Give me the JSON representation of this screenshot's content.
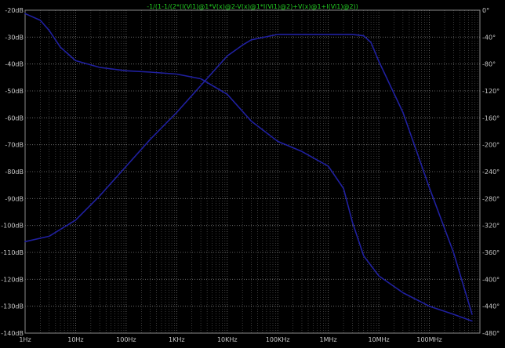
{
  "window": {
    "background": "#000000"
  },
  "plot": {
    "expression": "-1/(1-1/(2*(I(Vi1)@1*V(x)@2-V(x)@1*I(Vi1)@2)+V(x)@1+I(Vi1)@2))",
    "grid_color": "#606060",
    "trace_color": "#2020a0",
    "expression_color": "#22cc22"
  },
  "chart_data": {
    "type": "line",
    "title": "-1/(1-1/(2*(I(Vi1)@1*V(x)@2-V(x)@1*I(Vi1)@2)+V(x)@1+I(Vi1)@2))",
    "x_scale": "log",
    "xlim": [
      1,
      1000000000
    ],
    "x_ticks": [
      1,
      10,
      100,
      1000,
      10000,
      100000,
      1000000,
      10000000,
      100000000
    ],
    "x_tick_labels": [
      "1Hz",
      "10Hz",
      "100Hz",
      "1KHz",
      "10KHz",
      "100KHz",
      "1MHz",
      "10MHz",
      "100MHz"
    ],
    "ylim_left": [
      -140,
      -20
    ],
    "y_left_ticks": [
      -20,
      -30,
      -40,
      -50,
      -60,
      -70,
      -80,
      -90,
      -100,
      -110,
      -120,
      -130,
      -140
    ],
    "y_left_tick_labels": [
      "-20dB",
      "-30dB",
      "-40dB",
      "-50dB",
      "-60dB",
      "-70dB",
      "-80dB",
      "-90dB",
      "-100dB",
      "-110dB",
      "-120dB",
      "-130dB",
      "-140dB"
    ],
    "ylim_right": [
      -480,
      0
    ],
    "y_right_ticks": [
      0,
      -40,
      -80,
      -120,
      -160,
      -200,
      -240,
      -280,
      -320,
      -360,
      -400,
      -440,
      -480
    ],
    "y_right_tick_labels": [
      "0°",
      "-40°",
      "-80°",
      "-120°",
      "-160°",
      "-200°",
      "-240°",
      "-280°",
      "-320°",
      "-360°",
      "-400°",
      "-440°",
      "-480°"
    ],
    "grid": true,
    "series": [
      {
        "axis": "left",
        "x": [
          1,
          3,
          10,
          30,
          100,
          300,
          1000,
          3000,
          10000,
          20000,
          30000,
          100000,
          300000,
          1000000,
          2000000,
          3000000,
          5000000,
          7000000,
          10000000,
          30000000,
          100000000,
          300000000,
          700000000
        ],
        "y": [
          -106,
          -104,
          -98,
          -89,
          -78,
          -68,
          -58,
          -48,
          -37,
          -33,
          -31,
          -29,
          -29,
          -29,
          -29,
          -29,
          -29.5,
          -32,
          -39,
          -58,
          -86,
          -110,
          -133
        ]
      },
      {
        "axis": "right",
        "x": [
          1,
          2,
          3,
          5,
          10,
          30,
          100,
          300,
          1000,
          3000,
          10000,
          30000,
          100000,
          300000,
          1000000,
          2000000,
          3000000,
          5000000,
          10000000,
          30000000,
          100000000,
          300000000,
          700000000
        ],
        "y": [
          -5,
          -15,
          -30,
          -55,
          -75,
          -85,
          -90,
          -92,
          -95,
          -102,
          -125,
          -165,
          -195,
          -210,
          -232,
          -265,
          -315,
          -365,
          -395,
          -420,
          -440,
          -452,
          -462
        ]
      }
    ]
  }
}
